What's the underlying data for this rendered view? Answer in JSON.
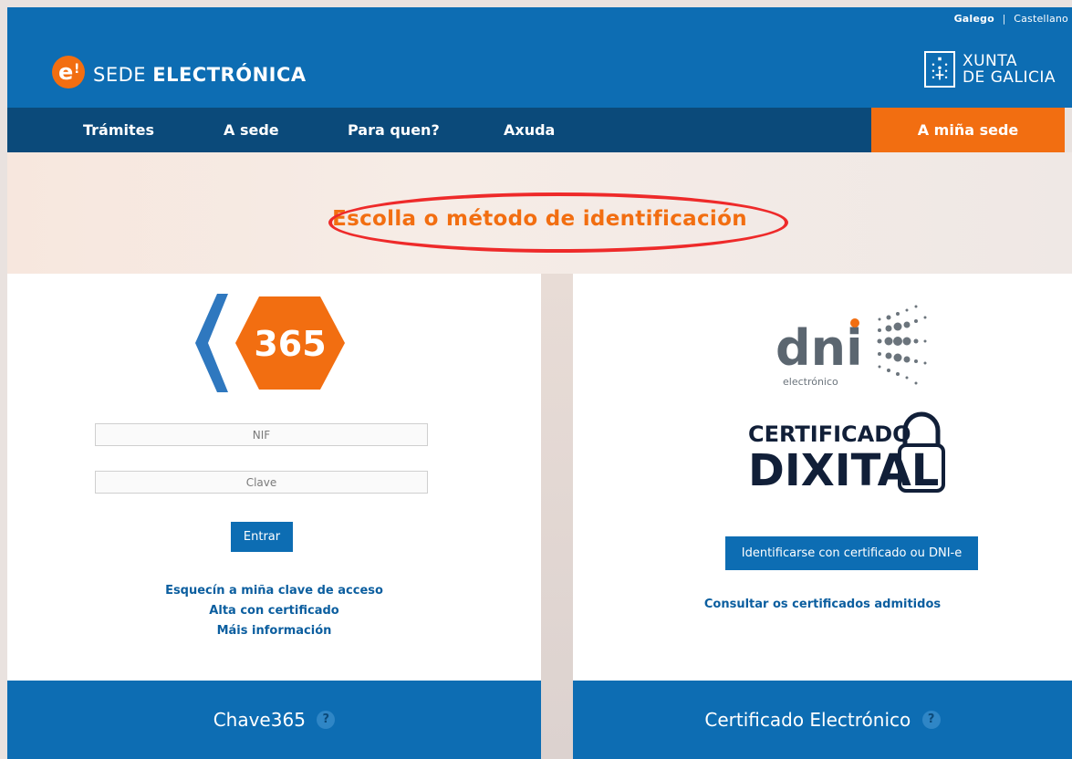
{
  "languages": {
    "galego": "Galego",
    "separator": "|",
    "castellano": "Castellano"
  },
  "brand": {
    "prefix": "SEDE",
    "name": "ELECTRÓNICA",
    "logo_icon": "e-exclamation-logo"
  },
  "xunta": {
    "line1": "XUNTA",
    "line2": "DE GALICIA"
  },
  "nav": {
    "items": [
      "Trámites",
      "A sede",
      "Para quen?",
      "Axuda"
    ],
    "cta": "A miña sede"
  },
  "hero": {
    "title": "Escolla o método de identificación"
  },
  "chave365": {
    "logo_text": "365",
    "nif_placeholder": "NIF",
    "clave_placeholder": "Clave",
    "submit_label": "Entrar",
    "links": [
      "Esquecín a miña clave de acceso",
      "Alta con certificado",
      "Máis información"
    ],
    "footer_title": "Chave365",
    "help": "?"
  },
  "certificado": {
    "dni_text": "dni",
    "dni_sub": "electrónico",
    "cert_line1": "CERTIFICADO",
    "cert_line2": "DIXITAL",
    "button_label": "Identificarse con certificado ou DNI-e",
    "link": "Consultar os certificados admitidos",
    "footer_title": "Certificado Electrónico",
    "help": "?"
  },
  "colors": {
    "header_blue": "#0d6db3",
    "nav_dark": "#0b4a7a",
    "accent_orange": "#f26e11",
    "annotation_red": "#ee2a2a"
  }
}
